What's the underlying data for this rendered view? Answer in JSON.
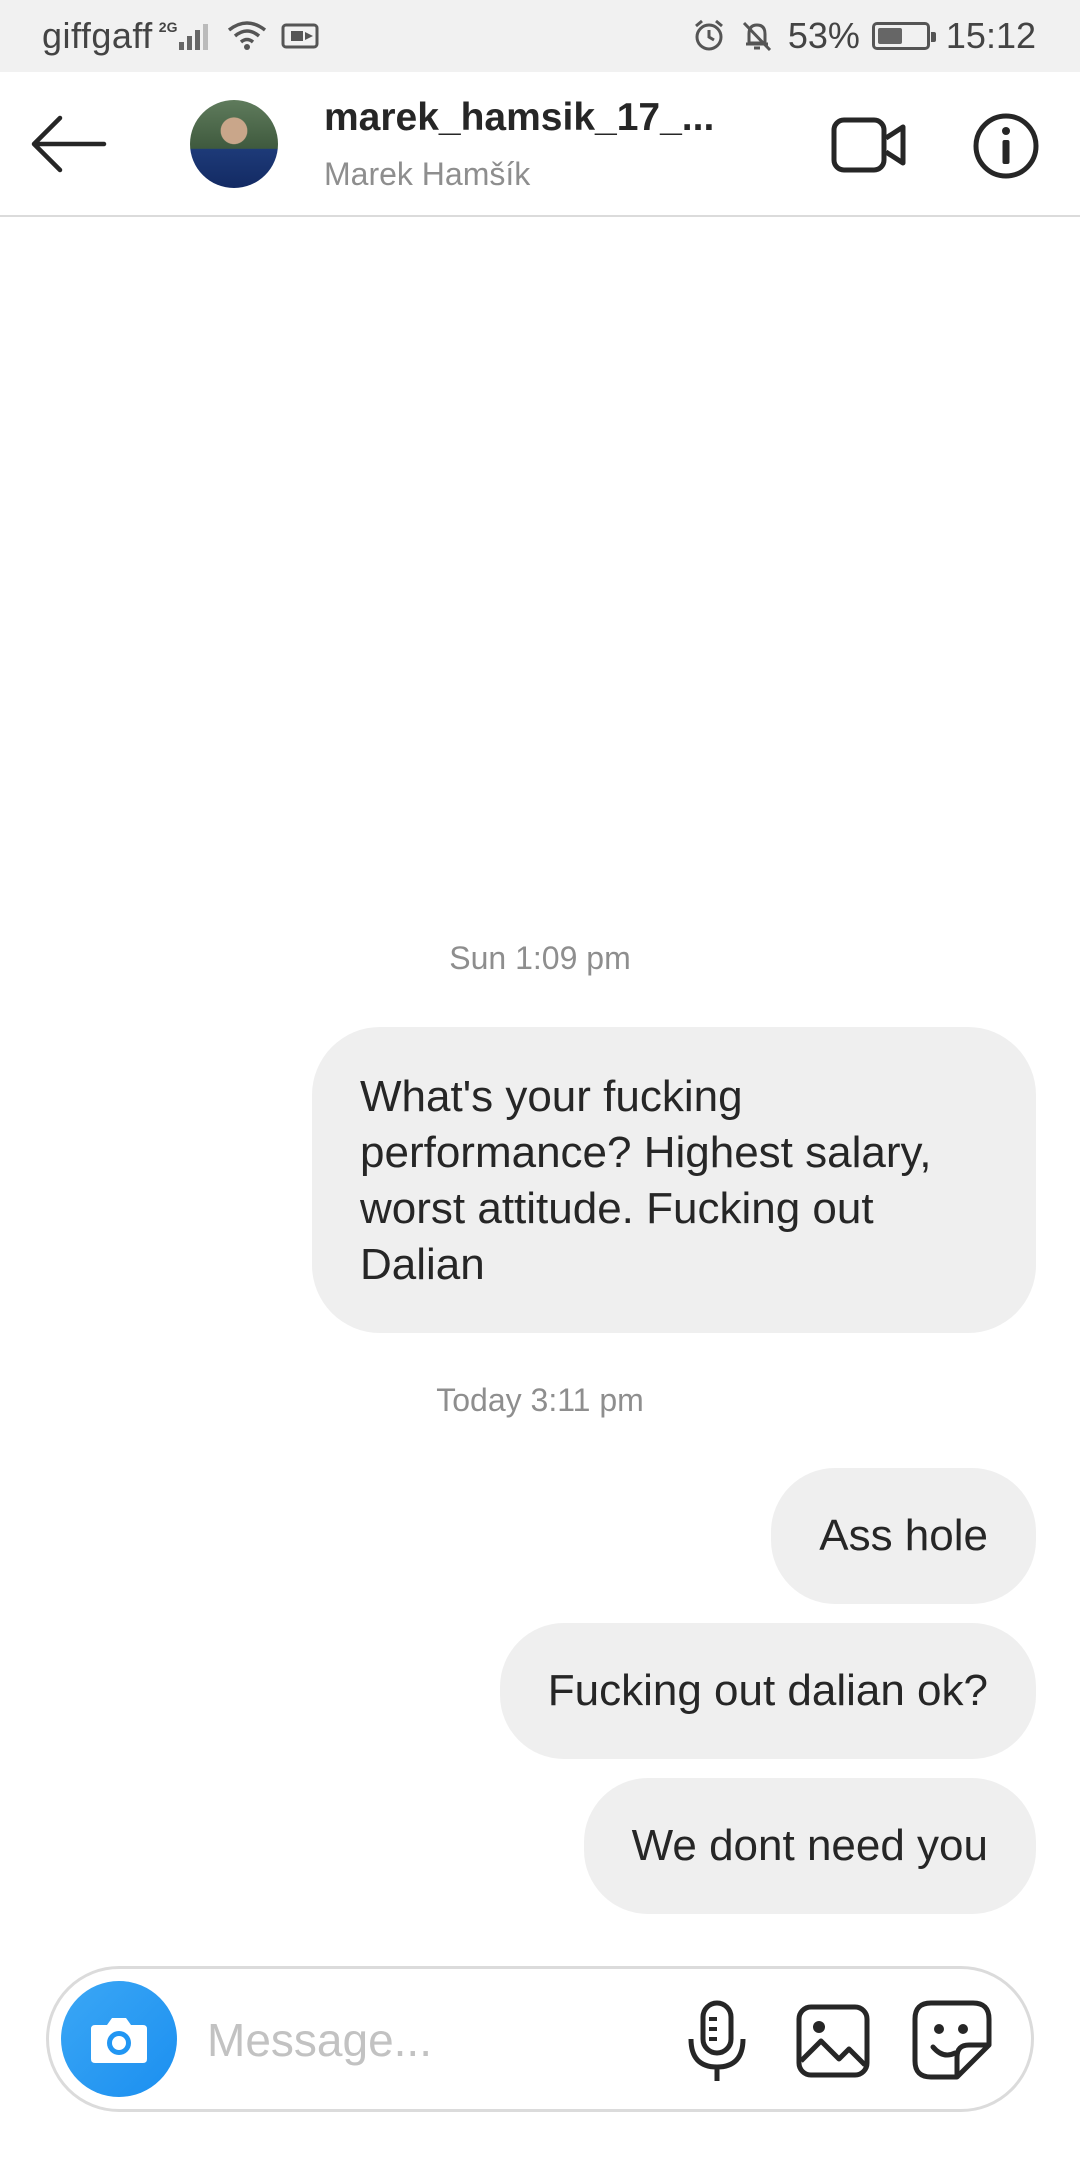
{
  "status_bar": {
    "carrier": "giffgaff",
    "network_type": "2G",
    "battery_percent": "53%",
    "battery_level": 0.53,
    "time": "15:12",
    "icons": [
      "signal-icon",
      "wifi-icon",
      "cast-icon",
      "alarm-icon",
      "notifications-off-icon",
      "battery-icon"
    ]
  },
  "header": {
    "username": "marek_hamsik_17_...",
    "full_name": "Marek Hamšík",
    "icons": [
      "back-arrow-icon",
      "avatar",
      "video-call-icon",
      "info-icon"
    ]
  },
  "messages": [
    {
      "timestamp": "Sun 1:09 pm"
    },
    {
      "text": "What's your fucking performance? Highest salary, worst attitude. Fucking out Dalian",
      "sender": "me"
    },
    {
      "timestamp": "Today 3:11 pm"
    },
    {
      "text": "Ass hole",
      "sender": "me"
    },
    {
      "text": "Fucking out dalian ok?",
      "sender": "me"
    },
    {
      "text": "We dont need you",
      "sender": "me"
    }
  ],
  "composer": {
    "placeholder": "Message...",
    "icons": [
      "camera-icon",
      "microphone-icon",
      "gallery-icon",
      "sticker-icon"
    ]
  },
  "colors": {
    "status_bar_bg": "#f1f1f1",
    "bubble_bg": "#efefef",
    "camera_button": "#2196f3",
    "secondary_text": "#8e8e8e"
  }
}
